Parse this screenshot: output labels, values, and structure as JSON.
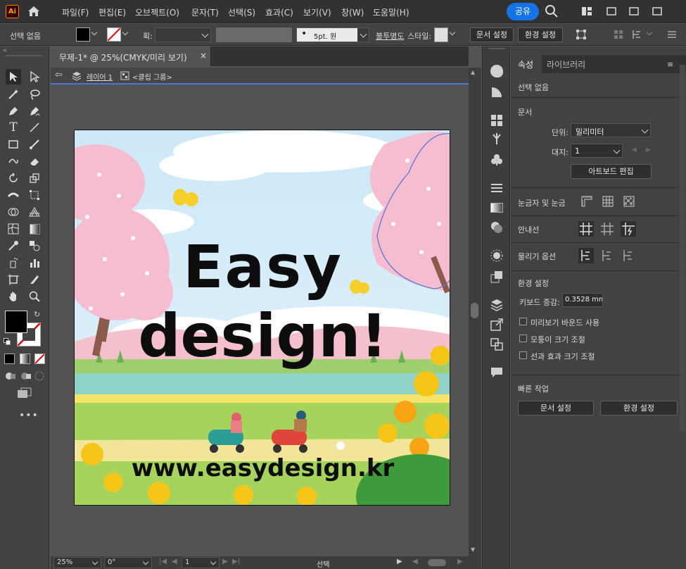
{
  "app": {
    "logo": "Ai"
  },
  "menu": {
    "items": [
      "파일(F)",
      "편집(E)",
      "오브젝트(O)",
      "문자(T)",
      "선택(S)",
      "효과(C)",
      "보기(V)",
      "창(W)",
      "도움말(H)"
    ],
    "share": "공유"
  },
  "control": {
    "selection_status": "선택 없음",
    "stroke_label": "획:",
    "brush_label": "5pt. 원",
    "opacity_label": "불투명도",
    "style_label": "스타일:",
    "doc_setup": "문서 설정",
    "prefs": "환경 설정"
  },
  "document": {
    "tab_title": "무제-1* @ 25%(CMYK/미리 보기)",
    "layer": "레이어 1",
    "clip_group": "<클립 그룹>",
    "artwork": {
      "title_line1": "Easy",
      "title_line2": "design!",
      "url": "www.easydesign.kr"
    }
  },
  "status": {
    "zoom": "25%",
    "rotation": "0°",
    "artboard_num": "1",
    "tool": "선택"
  },
  "panel": {
    "tabs": [
      "속성",
      "라이브러리"
    ],
    "active_tab": "속성",
    "no_selection": "선택 없음",
    "document_title": "문서",
    "unit_label": "단위:",
    "unit_value": "밀리미터",
    "artboard_label": "대지:",
    "artboard_value": "1",
    "edit_artboard": "아트보드 편집",
    "rulers_grids": "눈금자 및 눈금",
    "guides": "안내선",
    "snap_options": "물리기 옵션",
    "prefs_title": "환경 설정",
    "keyboard_inc_label": "키보드 증감:",
    "keyboard_inc_value": "0.3528 mm",
    "cb_preview_bounds": "미리보기 바운드 사용",
    "cb_scale_corners": "모퉁이 크기 조절",
    "cb_scale_strokes": "선과 효과 크기 조절",
    "quick_actions": "빠른 작업",
    "qa_doc_setup": "문서 설정",
    "qa_prefs": "환경 설정"
  },
  "colors": {
    "accent": "#1473e6",
    "bg_dark": "#323232",
    "panel": "#424242",
    "canvas": "#535353"
  }
}
